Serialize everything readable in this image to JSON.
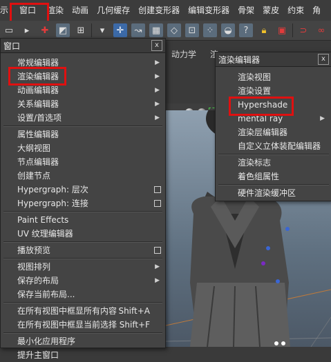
{
  "menubar": {
    "items": [
      "示",
      "窗口",
      "渲染",
      "动画",
      "几何缓存",
      "创建变形器",
      "编辑变形器",
      "骨架",
      "蒙皮",
      "约束",
      "角"
    ]
  },
  "shelf": {
    "tab_label": "动力学",
    "tab_label2": "渲"
  },
  "window_menu": {
    "title": "窗口",
    "close": "x",
    "items": [
      {
        "label": "常规编辑器",
        "type": "arrow"
      },
      {
        "label": "渲染编辑器",
        "type": "arrow"
      },
      {
        "label": "动画编辑器",
        "type": "arrow"
      },
      {
        "label": "关系编辑器",
        "type": "arrow"
      },
      {
        "label": "设置/首选项",
        "type": "arrow"
      },
      {
        "label": "属性编辑器",
        "type": "plain"
      },
      {
        "label": "大纲视图",
        "type": "plain"
      },
      {
        "label": "节点编辑器",
        "type": "plain"
      },
      {
        "label": "创建节点",
        "type": "plain"
      },
      {
        "label": "Hypergraph: 层次",
        "type": "option"
      },
      {
        "label": "Hypergraph: 连接",
        "type": "option"
      },
      {
        "label": "Paint Effects",
        "type": "plain"
      },
      {
        "label": "UV 纹理编辑器",
        "type": "plain"
      },
      {
        "label": "播放预览",
        "type": "option"
      },
      {
        "label": "视图排列",
        "type": "arrow"
      },
      {
        "label": "保存的布局",
        "type": "arrow"
      },
      {
        "label": "保存当前布局...",
        "type": "plain"
      },
      {
        "label": "在所有视图中框显所有内容",
        "type": "shortcut",
        "shortcut": "Shift+A"
      },
      {
        "label": "在所有视图中框显当前选择",
        "type": "shortcut",
        "shortcut": "Shift+F"
      },
      {
        "label": "最小化应用程序",
        "type": "plain"
      },
      {
        "label": "提升主窗口",
        "type": "plain"
      }
    ]
  },
  "render_menu": {
    "title": "渲染编辑器",
    "close": "x",
    "items": [
      {
        "label": "渲染视图",
        "type": "plain"
      },
      {
        "label": "渲染设置",
        "type": "plain"
      },
      {
        "label": "Hypershade",
        "type": "plain"
      },
      {
        "label": "mental ray",
        "type": "arrow"
      },
      {
        "label": "渲染层编辑器",
        "type": "plain"
      },
      {
        "label": "自定义立体装配编辑器",
        "type": "plain"
      },
      {
        "label": "渲染标志",
        "type": "plain"
      },
      {
        "label": "着色组属性",
        "type": "plain"
      },
      {
        "label": "硬件渲染缓冲区",
        "type": "plain"
      }
    ]
  },
  "colors": {
    "highlight": "#e01010",
    "menu_bg": "#444444"
  }
}
